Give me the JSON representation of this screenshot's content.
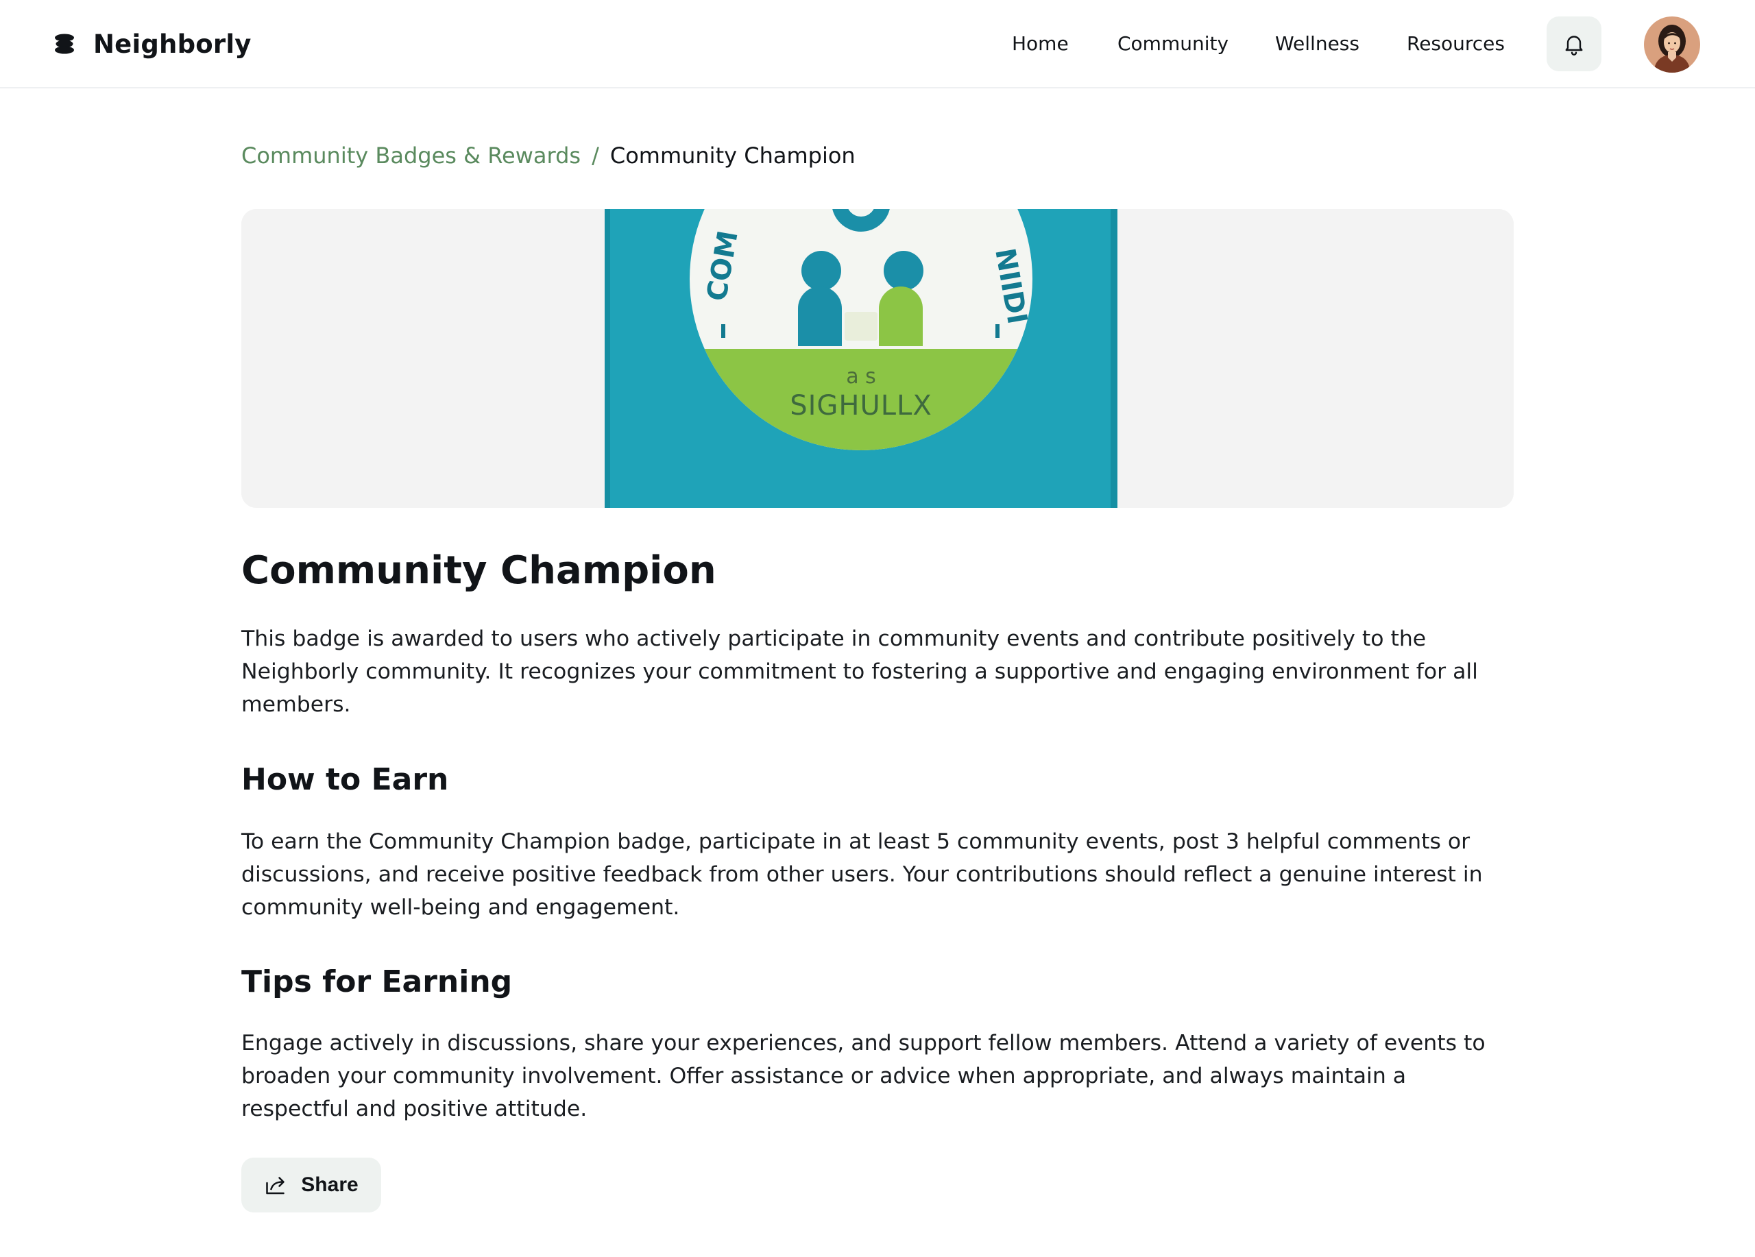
{
  "header": {
    "brand": "Neighborly",
    "brand_icon": "stack-logo-icon",
    "nav": [
      {
        "label": "Home"
      },
      {
        "label": "Community"
      },
      {
        "label": "Wellness"
      },
      {
        "label": "Resources"
      }
    ],
    "notification_icon": "bell-icon",
    "avatar_icon": "user-avatar"
  },
  "breadcrumb": {
    "parent": "Community Badges & Rewards",
    "separator": "/",
    "current": "Community Champion"
  },
  "hero": {
    "image_icon": "community-champion-badge-image"
  },
  "badge": {
    "title": "Community Champion",
    "description": "This badge is awarded to users who actively participate in community events and contribute positively to the Neighborly community. It recognizes your commitment to fostering a supportive and engaging environment for all members."
  },
  "how_to_earn": {
    "heading": "How to Earn",
    "text": "To earn the Community Champion badge, participate in at least 5 community events, post 3 helpful comments or discussions, and receive positive feedback from other users. Your contributions should reflect a genuine interest in community well-being and engagement."
  },
  "tips": {
    "heading": "Tips for Earning",
    "text": "Engage actively in discussions, share your experiences, and support fellow members. Attend a variety of events to broaden your community involvement. Offer assistance or advice when appropriate, and always maintain a respectful and positive attitude."
  },
  "actions": {
    "share_label": "Share",
    "share_icon": "share-icon"
  },
  "colors": {
    "accent_green": "#5a8a5e",
    "button_bg": "#eef2f0",
    "badge_teal": "#1fa3b8",
    "badge_green": "#8cc545"
  }
}
